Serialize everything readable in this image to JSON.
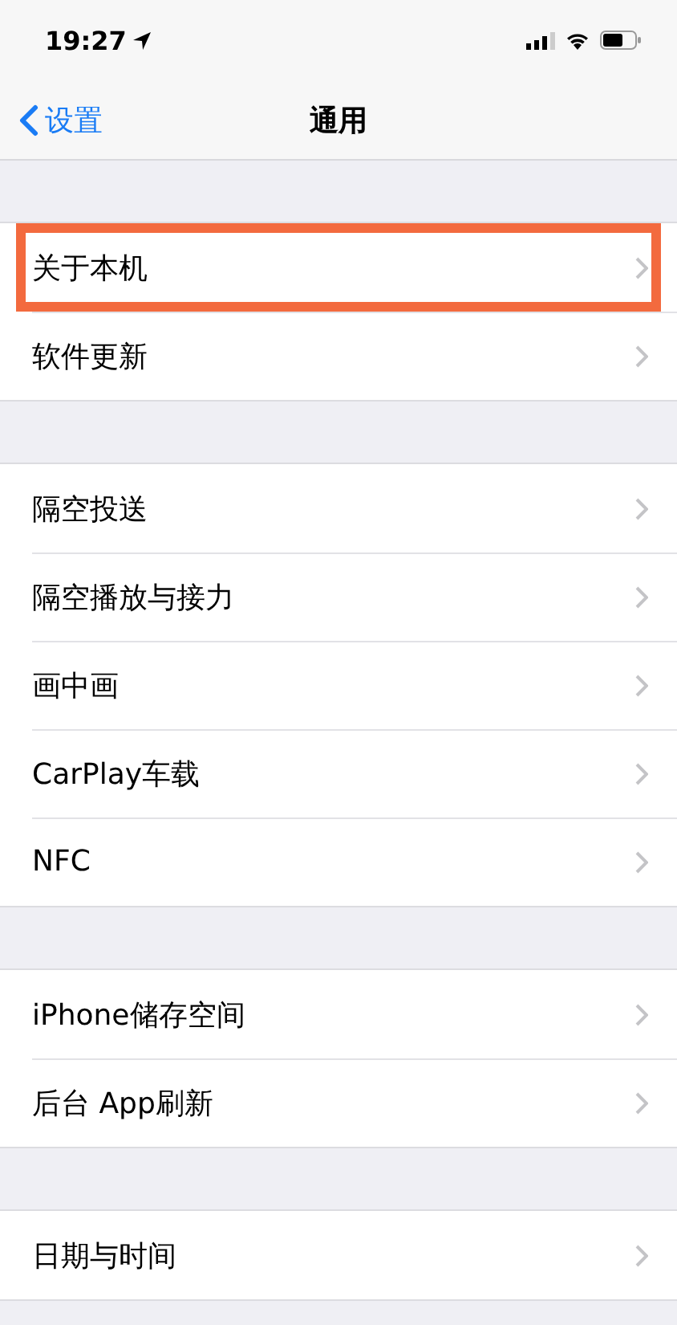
{
  "status_bar": {
    "time": "19:27"
  },
  "nav_bar": {
    "back": "设置",
    "title": "通用"
  },
  "groups": [
    {
      "rows": [
        {
          "label": "关于本机",
          "highlighted": true
        },
        {
          "label": "软件更新",
          "highlighted": false
        }
      ]
    },
    {
      "rows": [
        {
          "label": "隔空投送",
          "highlighted": false
        },
        {
          "label": "隔空播放与接力",
          "highlighted": false
        },
        {
          "label": "画中画",
          "highlighted": false
        },
        {
          "label": "CarPlay车载",
          "highlighted": false
        },
        {
          "label": "NFC",
          "highlighted": false
        }
      ]
    },
    {
      "rows": [
        {
          "label": "iPhone储存空间",
          "highlighted": false
        },
        {
          "label": "后台 App刷新",
          "highlighted": false
        }
      ]
    },
    {
      "rows": [
        {
          "label": "日期与时间",
          "highlighted": false
        }
      ]
    }
  ]
}
